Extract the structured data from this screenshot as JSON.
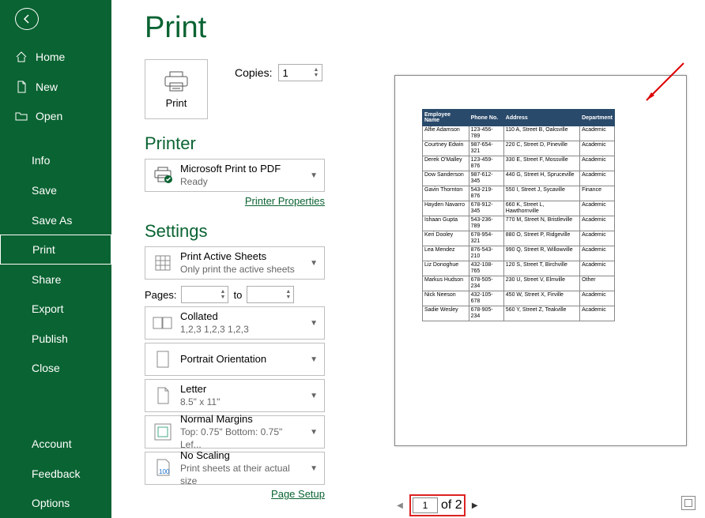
{
  "nav": {
    "home": "Home",
    "new": "New",
    "open": "Open",
    "info": "Info",
    "save": "Save",
    "saveas": "Save As",
    "print": "Print",
    "share": "Share",
    "export": "Export",
    "publish": "Publish",
    "close": "Close",
    "account": "Account",
    "feedback": "Feedback",
    "options": "Options"
  },
  "title": "Print",
  "print_btn": "Print",
  "copies_label": "Copies:",
  "copies_value": "1",
  "printer_section": "Printer",
  "printer": {
    "name": "Microsoft Print to PDF",
    "status": "Ready"
  },
  "printer_props": "Printer Properties",
  "settings_section": "Settings",
  "settings": {
    "active": {
      "t": "Print Active Sheets",
      "s": "Only print the active sheets"
    },
    "pages_label": "Pages:",
    "to_label": "to",
    "collated": {
      "t": "Collated",
      "s": "1,2,3    1,2,3    1,2,3"
    },
    "orient": {
      "t": "Portrait Orientation"
    },
    "paper": {
      "t": "Letter",
      "s": "8.5\" x 11\""
    },
    "margins": {
      "t": "Normal Margins",
      "s": "Top: 0.75\" Bottom: 0.75\" Lef..."
    },
    "scaling": {
      "t": "No Scaling",
      "s": "Print sheets at their actual size"
    }
  },
  "page_setup": "Page Setup",
  "table": {
    "headers": [
      "Employee Name",
      "Phone No.",
      "Address",
      "Department"
    ],
    "rows": [
      [
        "Alfie Adamson",
        "123-456-789",
        "110 A, Street B, Oaksville",
        "Academic"
      ],
      [
        "Courtney Edwin",
        "987-654-321",
        "220 C, Street D, Pineville",
        "Academic"
      ],
      [
        "Derek O'Malley",
        "123-459-876",
        "330 E, Street F, Mossville",
        "Academic"
      ],
      [
        "Dow Sanderson",
        "987-612-345",
        "440 G, Street H, Spruceville",
        "Academic"
      ],
      [
        "Gavin Thornton",
        "543-219-876",
        "550 I, Street J, Sycaville",
        "Finance"
      ],
      [
        "Hayden Navarro",
        "678-912-345",
        "660 K, Street L, Hawthornville",
        "Academic"
      ],
      [
        "Ishaan Gupta",
        "543-236-789",
        "770 M, Street N, Bristleville",
        "Academic"
      ],
      [
        "Keri Dooley",
        "678-954-321",
        "880 O, Street P, Ridgeville",
        "Academic"
      ],
      [
        "Lea Mendez",
        "876-543-210",
        "990 Q, Street R, Willowville",
        "Academic"
      ],
      [
        "Liz Donoghue",
        "432-108-765",
        "120 S, Street T, Birchville",
        "Academic"
      ],
      [
        "Markus Hudson",
        "678-505-234",
        "230 U, Street V, Elmville",
        "Other"
      ],
      [
        "Nick Neeson",
        "432-105-678",
        "450 W, Street X, Firville",
        "Academic"
      ],
      [
        "Sadie Wesley",
        "678-905-234",
        "560 Y, Street Z, Teakville",
        "Academic"
      ]
    ]
  },
  "pager": {
    "current": "1",
    "total": "of 2"
  }
}
